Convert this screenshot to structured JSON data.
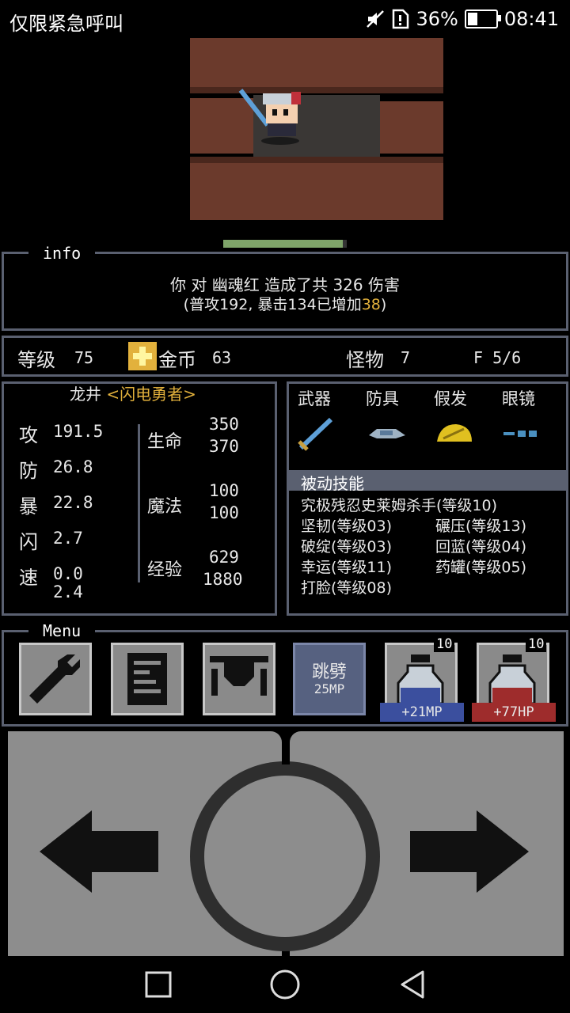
{
  "status_bar": {
    "carrier": "仅限紧急呼叫",
    "battery": "36%",
    "time": "08:41",
    "battery_level": 0.36
  },
  "hero": {
    "hp_fraction": 0.97
  },
  "info": {
    "title": "info",
    "line1": "你 对 幽魂红 造成了共 326 伤害",
    "line2_prefix": "(普攻192, 暴击134已增加",
    "line2_bonus": "38",
    "line2_suffix": ")"
  },
  "summary": {
    "level_label": "等级",
    "level_value": "75",
    "gold_label": "金币",
    "gold_value": "63",
    "monster_label": "怪物",
    "monster_value": "7",
    "floor": "F 5/6"
  },
  "character": {
    "name": "龙井",
    "title": "<闪电勇者>",
    "stats": [
      {
        "label": "攻",
        "value": "191.5"
      },
      {
        "label": "防",
        "value": "26.8"
      },
      {
        "label": "暴",
        "value": "22.8"
      },
      {
        "label": "闪",
        "value": "2.7"
      },
      {
        "label": "速",
        "value": "0.0",
        "value2": "2.4"
      }
    ],
    "hp": {
      "label": "生命",
      "current": "350",
      "max": "370"
    },
    "mp": {
      "label": "魔法",
      "current": "100",
      "max": "100"
    },
    "exp": {
      "label": "经验",
      "current": "629",
      "max": "1880"
    }
  },
  "equipment": {
    "slots": [
      {
        "label": "武器",
        "icon": "sword-icon"
      },
      {
        "label": "防具",
        "icon": "armor-icon"
      },
      {
        "label": "假发",
        "icon": "wig-icon"
      },
      {
        "label": "眼镜",
        "icon": "glasses-icon"
      }
    ],
    "passive_title": "被动技能",
    "skills": [
      "究极残忍史莱姆杀手(等级10)",
      "坚韧(等级03)",
      "碾压(等级13)",
      "破绽(等级03)",
      "回蓝(等级04)",
      "幸运(等级11)",
      "药罐(等级05)",
      "打脸(等级08)"
    ]
  },
  "menu": {
    "title": "Menu",
    "skill_button": {
      "name": "跳劈",
      "cost": "25MP"
    },
    "mp_potion": {
      "count": "10",
      "effect": "+21MP",
      "color": "#3b4f9e"
    },
    "hp_potion": {
      "count": "10",
      "effect": "+77HP",
      "color": "#9e2c2c"
    }
  }
}
